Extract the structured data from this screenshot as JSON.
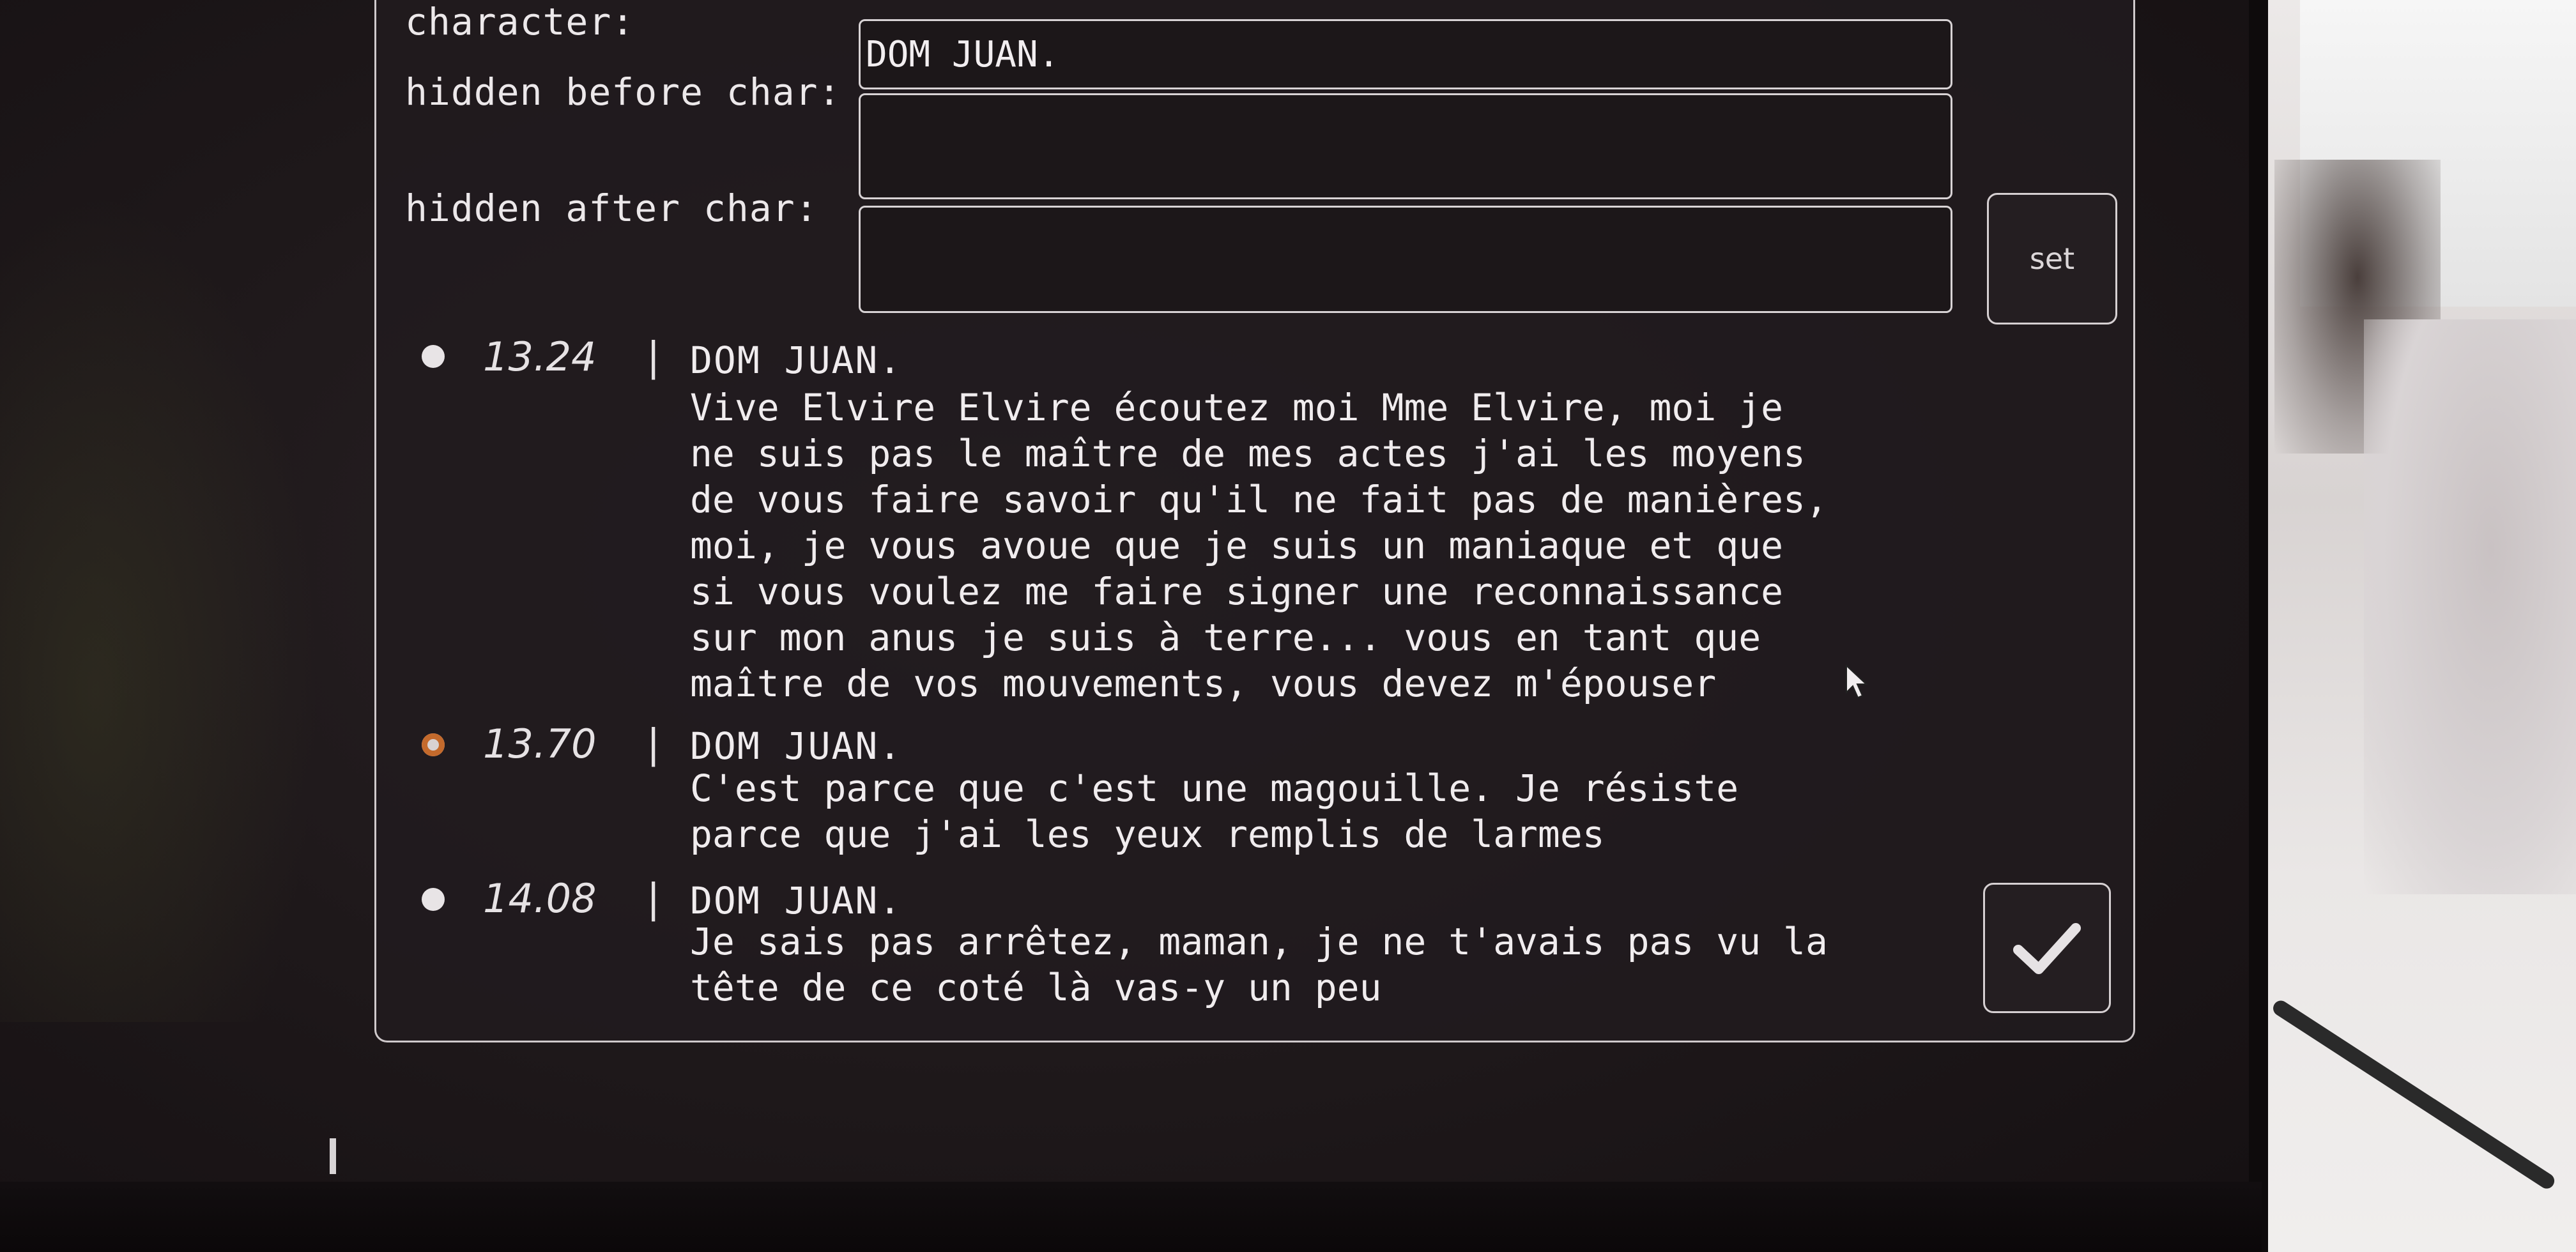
{
  "form": {
    "character_label": "character:",
    "character_value": "DOM JUAN.",
    "hidden_before_label": "hidden before char:",
    "hidden_before_value": "",
    "hidden_after_label": "hidden after char:",
    "hidden_after_value": "",
    "set_label": "set"
  },
  "entries": [
    {
      "time": "13.24",
      "separator": "|",
      "speaker": "DOM JUAN.",
      "lines": [
        "Vive Elvire Elvire écoutez moi Mme Elvire, moi je",
        "ne suis pas le maître de mes actes j'ai les moyens",
        "de vous faire savoir qu'il ne fait pas de manières,",
        "moi, je vous avoue que je suis un maniaque et que",
        "si vous voulez me faire signer une reconnaissance",
        "sur mon anus je suis à terre... vous en tant que",
        "maître de vos mouvements, vous devez m'épouser"
      ],
      "status": "default"
    },
    {
      "time": "13.70",
      "separator": "|",
      "speaker": "DOM JUAN.",
      "lines": [
        "C'est parce que c'est une magouille. Je résiste",
        "parce que j'ai les yeux remplis de larmes"
      ],
      "status": "active"
    },
    {
      "time": "14.08",
      "separator": "|",
      "speaker": "DOM JUAN.",
      "lines": [
        "Je sais pas arrêtez, maman, je ne t'avais pas vu la",
        "tête de ce coté là vas-y un peu"
      ],
      "status": "default"
    }
  ],
  "icons": {
    "confirm": "checkmark-icon",
    "bullet": "dot-icon",
    "active_bullet": "active-dot-icon",
    "pointer": "mouse-pointer-icon"
  },
  "colors": {
    "panel_bg": "#211b1e",
    "border": "#cfc9cb",
    "text": "#f0ecee",
    "active_accent": "#c46a2c"
  }
}
